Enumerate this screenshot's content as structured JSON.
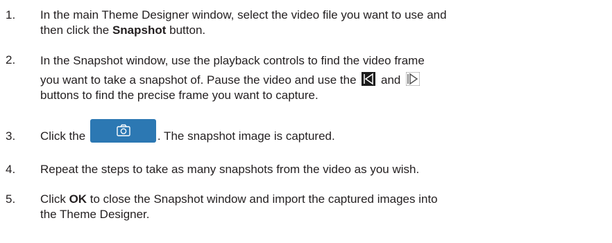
{
  "steps": [
    {
      "number": "1.",
      "line1": "In the main Theme Designer window, select the video file you want to use and",
      "line2_pre": "then click the ",
      "line2_bold": "Snapshot",
      "line2_post": " button."
    },
    {
      "number": "2.",
      "line1": "In the Snapshot window, use the playback controls to find the video frame",
      "line2_pre": "you want to take a snapshot of. Pause the video and use the",
      "line2_mid": "and",
      "line3": "buttons to find the precise frame you want to capture.",
      "prev_icon": "previous-frame-icon",
      "next_icon": "next-frame-icon"
    },
    {
      "number": "3.",
      "pre": "Click the",
      "post": ". The snapshot image is captured.",
      "button_icon": "camera-icon",
      "accent": "#2c78b3"
    },
    {
      "number": "4.",
      "text": "Repeat the steps to take as many snapshots from the video as you wish."
    },
    {
      "number": "5.",
      "pre": "Click ",
      "bold": "OK",
      "line1_post": " to close the Snapshot window and import the captured images into",
      "line2": "the Theme Designer."
    }
  ]
}
